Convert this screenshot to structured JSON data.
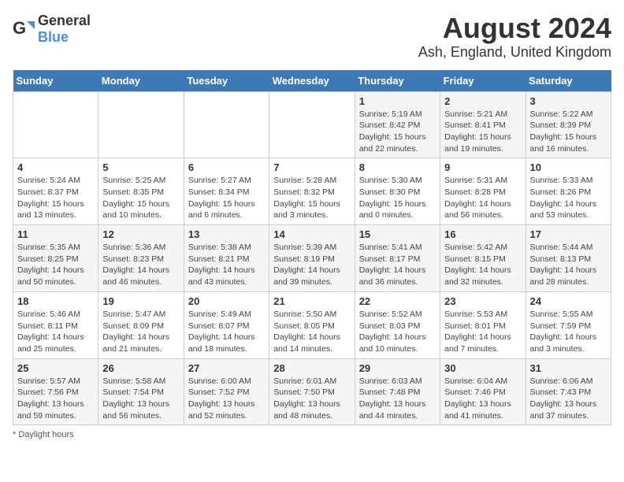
{
  "logo": {
    "text_general": "General",
    "text_blue": "Blue"
  },
  "title": "August 2024",
  "subtitle": "Ash, England, United Kingdom",
  "footer": "Daylight hours",
  "days_of_week": [
    "Sunday",
    "Monday",
    "Tuesday",
    "Wednesday",
    "Thursday",
    "Friday",
    "Saturday"
  ],
  "weeks": [
    [
      {
        "day": "",
        "info": ""
      },
      {
        "day": "",
        "info": ""
      },
      {
        "day": "",
        "info": ""
      },
      {
        "day": "",
        "info": ""
      },
      {
        "day": "1",
        "info": "Sunrise: 5:19 AM\nSunset: 8:42 PM\nDaylight: 15 hours\nand 22 minutes."
      },
      {
        "day": "2",
        "info": "Sunrise: 5:21 AM\nSunset: 8:41 PM\nDaylight: 15 hours\nand 19 minutes."
      },
      {
        "day": "3",
        "info": "Sunrise: 5:22 AM\nSunset: 8:39 PM\nDaylight: 15 hours\nand 16 minutes."
      }
    ],
    [
      {
        "day": "4",
        "info": "Sunrise: 5:24 AM\nSunset: 8:37 PM\nDaylight: 15 hours\nand 13 minutes."
      },
      {
        "day": "5",
        "info": "Sunrise: 5:25 AM\nSunset: 8:35 PM\nDaylight: 15 hours\nand 10 minutes."
      },
      {
        "day": "6",
        "info": "Sunrise: 5:27 AM\nSunset: 8:34 PM\nDaylight: 15 hours\nand 6 minutes."
      },
      {
        "day": "7",
        "info": "Sunrise: 5:28 AM\nSunset: 8:32 PM\nDaylight: 15 hours\nand 3 minutes."
      },
      {
        "day": "8",
        "info": "Sunrise: 5:30 AM\nSunset: 8:30 PM\nDaylight: 15 hours\nand 0 minutes."
      },
      {
        "day": "9",
        "info": "Sunrise: 5:31 AM\nSunset: 8:28 PM\nDaylight: 14 hours\nand 56 minutes."
      },
      {
        "day": "10",
        "info": "Sunrise: 5:33 AM\nSunset: 8:26 PM\nDaylight: 14 hours\nand 53 minutes."
      }
    ],
    [
      {
        "day": "11",
        "info": "Sunrise: 5:35 AM\nSunset: 8:25 PM\nDaylight: 14 hours\nand 50 minutes."
      },
      {
        "day": "12",
        "info": "Sunrise: 5:36 AM\nSunset: 8:23 PM\nDaylight: 14 hours\nand 46 minutes."
      },
      {
        "day": "13",
        "info": "Sunrise: 5:38 AM\nSunset: 8:21 PM\nDaylight: 14 hours\nand 43 minutes."
      },
      {
        "day": "14",
        "info": "Sunrise: 5:39 AM\nSunset: 8:19 PM\nDaylight: 14 hours\nand 39 minutes."
      },
      {
        "day": "15",
        "info": "Sunrise: 5:41 AM\nSunset: 8:17 PM\nDaylight: 14 hours\nand 36 minutes."
      },
      {
        "day": "16",
        "info": "Sunrise: 5:42 AM\nSunset: 8:15 PM\nDaylight: 14 hours\nand 32 minutes."
      },
      {
        "day": "17",
        "info": "Sunrise: 5:44 AM\nSunset: 8:13 PM\nDaylight: 14 hours\nand 28 minutes."
      }
    ],
    [
      {
        "day": "18",
        "info": "Sunrise: 5:46 AM\nSunset: 8:11 PM\nDaylight: 14 hours\nand 25 minutes."
      },
      {
        "day": "19",
        "info": "Sunrise: 5:47 AM\nSunset: 8:09 PM\nDaylight: 14 hours\nand 21 minutes."
      },
      {
        "day": "20",
        "info": "Sunrise: 5:49 AM\nSunset: 8:07 PM\nDaylight: 14 hours\nand 18 minutes."
      },
      {
        "day": "21",
        "info": "Sunrise: 5:50 AM\nSunset: 8:05 PM\nDaylight: 14 hours\nand 14 minutes."
      },
      {
        "day": "22",
        "info": "Sunrise: 5:52 AM\nSunset: 8:03 PM\nDaylight: 14 hours\nand 10 minutes."
      },
      {
        "day": "23",
        "info": "Sunrise: 5:53 AM\nSunset: 8:01 PM\nDaylight: 14 hours\nand 7 minutes."
      },
      {
        "day": "24",
        "info": "Sunrise: 5:55 AM\nSunset: 7:59 PM\nDaylight: 14 hours\nand 3 minutes."
      }
    ],
    [
      {
        "day": "25",
        "info": "Sunrise: 5:57 AM\nSunset: 7:56 PM\nDaylight: 13 hours\nand 59 minutes."
      },
      {
        "day": "26",
        "info": "Sunrise: 5:58 AM\nSunset: 7:54 PM\nDaylight: 13 hours\nand 56 minutes."
      },
      {
        "day": "27",
        "info": "Sunrise: 6:00 AM\nSunset: 7:52 PM\nDaylight: 13 hours\nand 52 minutes."
      },
      {
        "day": "28",
        "info": "Sunrise: 6:01 AM\nSunset: 7:50 PM\nDaylight: 13 hours\nand 48 minutes."
      },
      {
        "day": "29",
        "info": "Sunrise: 6:03 AM\nSunset: 7:48 PM\nDaylight: 13 hours\nand 44 minutes."
      },
      {
        "day": "30",
        "info": "Sunrise: 6:04 AM\nSunset: 7:46 PM\nDaylight: 13 hours\nand 41 minutes."
      },
      {
        "day": "31",
        "info": "Sunrise: 6:06 AM\nSunset: 7:43 PM\nDaylight: 13 hours\nand 37 minutes."
      }
    ]
  ]
}
